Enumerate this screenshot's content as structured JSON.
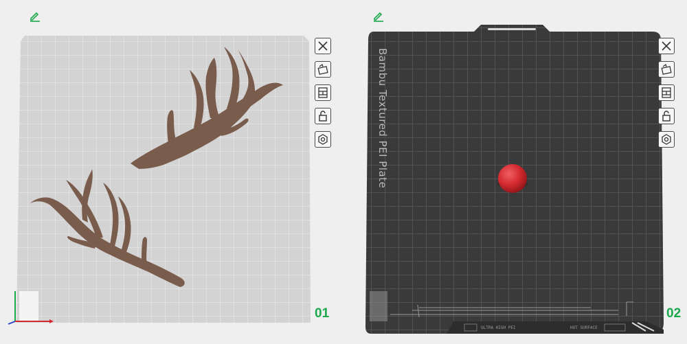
{
  "colors": {
    "accent": "#1aa84b",
    "antler": "#7a5c4c",
    "sphere": "#d42a2f",
    "dark_plate": "#3a3a3a",
    "light_plate": "#d4d4d4"
  },
  "plates": [
    {
      "number": "01",
      "type": "light-grid",
      "tools": [
        "close-icon",
        "auto-orient-icon",
        "arrange-icon",
        "lock-icon",
        "settings-icon"
      ]
    },
    {
      "number": "02",
      "type": "bambu-textured-pei",
      "plate_label": "Bambu Textured PEI Plate",
      "footer_text": "ULTRA HIGH PEI",
      "footer_text_2": "HOT SURFACE",
      "tools": [
        "close-icon",
        "auto-orient-icon",
        "arrange-icon",
        "lock-icon",
        "settings-icon"
      ]
    }
  ]
}
